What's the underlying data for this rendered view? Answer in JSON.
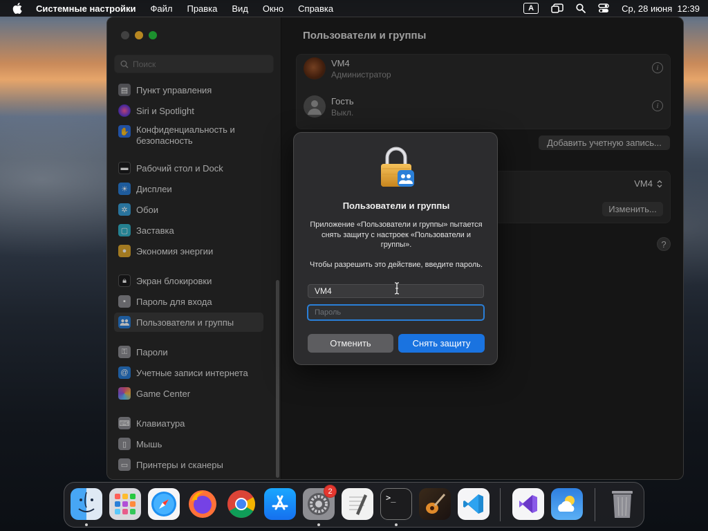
{
  "menubar": {
    "app_name": "Системные настройки",
    "items": [
      "Файл",
      "Правка",
      "Вид",
      "Окно",
      "Справка"
    ],
    "input_source": "A",
    "clock": "Ср, 28 июня  12:39"
  },
  "sidebar": {
    "search_placeholder": "Поиск",
    "items": [
      {
        "label": "Пункт управления",
        "color": "#6e6e73"
      },
      {
        "label": "Siri и Spotlight",
        "color": "#b14fd6"
      },
      {
        "label": "Конфиденциальность и безопасность",
        "color": "#2f6fe0"
      },
      {
        "label": "Рабочий стол и Dock",
        "color": "#1c1c1e"
      },
      {
        "label": "Дисплеи",
        "color": "#2a7fd8"
      },
      {
        "label": "Обои",
        "color": "#3aa0d8"
      },
      {
        "label": "Заставка",
        "color": "#33b3c9"
      },
      {
        "label": "Экономия энергии",
        "color": "#e0a82e"
      },
      {
        "label": "Экран блокировки",
        "color": "#1c1c1e"
      },
      {
        "label": "Пароль для входа",
        "color": "#8e8e93"
      },
      {
        "label": "Пользователи и группы",
        "color": "#2a7fd8"
      },
      {
        "label": "Пароли",
        "color": "#8e8e93"
      },
      {
        "label": "Учетные записи интернета",
        "color": "#2a7fd8"
      },
      {
        "label": "Game Center",
        "color": "#e85a8a"
      },
      {
        "label": "Клавиатура",
        "color": "#8e8e93"
      },
      {
        "label": "Мышь",
        "color": "#8e8e93"
      },
      {
        "label": "Принтеры и сканеры",
        "color": "#8e8e93"
      }
    ]
  },
  "main": {
    "title": "Пользователи и группы",
    "users": [
      {
        "name": "VM4",
        "role": "Администратор"
      },
      {
        "name": "Гость",
        "role": "Выкл."
      }
    ],
    "add_account_label": "Добавить учетную запись...",
    "auto_login_value": "VM4",
    "edit_label": "Изменить...",
    "help_label": "?"
  },
  "dialog": {
    "title": "Пользователи и группы",
    "message": "Приложение «Пользователи и группы» пытается снять защиту с настроек «Пользователи и группы».",
    "message2": "Чтобы разрешить это действие, введите пароль.",
    "username_value": "VM4",
    "password_placeholder": "Пароль",
    "cancel_label": "Отменить",
    "unlock_label": "Снять защиту"
  },
  "dock": {
    "apps": [
      "finder",
      "launchpad",
      "safari",
      "firefox",
      "chrome",
      "app-store",
      "system-settings",
      "textedit",
      "terminal",
      "garageband",
      "vscode",
      "visual-studio",
      "weather",
      "trash"
    ],
    "system_settings_badge": "2"
  }
}
